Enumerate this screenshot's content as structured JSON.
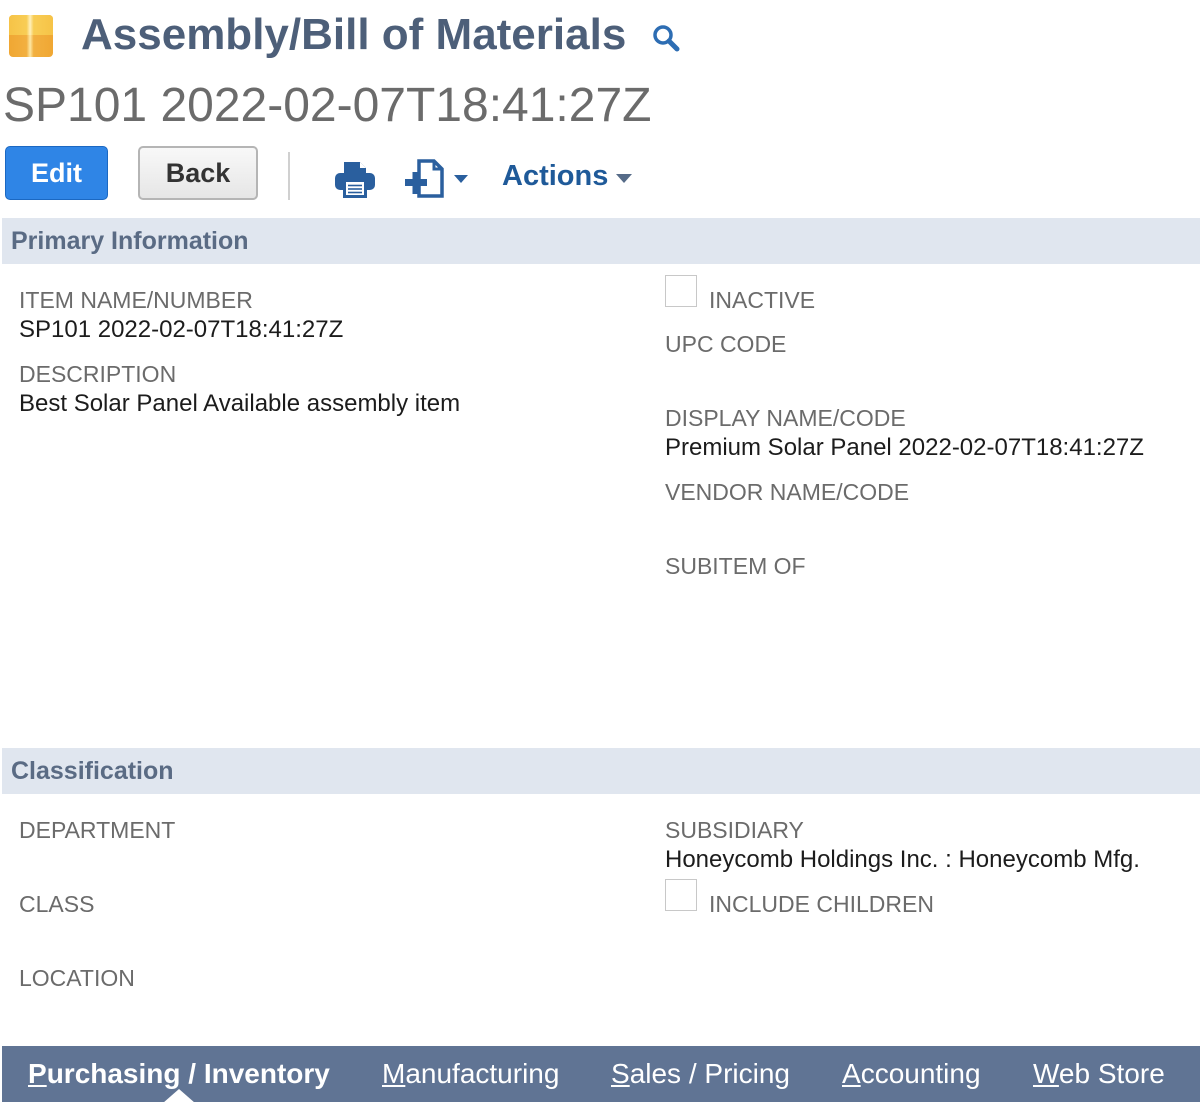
{
  "header": {
    "record_type": "Assembly/Bill of Materials",
    "record_title": "SP101 2022-02-07T18:41:27Z",
    "icons": {
      "record": "package-icon",
      "search": "search-icon"
    }
  },
  "toolbar": {
    "edit_label": "Edit",
    "back_label": "Back",
    "print_icon": "print-icon",
    "new_doc_icon": "new-document-icon",
    "actions_label": "Actions"
  },
  "primary": {
    "title": "Primary Information",
    "item_name_label": "ITEM NAME/NUMBER",
    "item_name_value": "SP101 2022-02-07T18:41:27Z",
    "description_label": "DESCRIPTION",
    "description_value": "Best Solar Panel Available assembly item",
    "inactive_label": "INACTIVE",
    "inactive_checked": false,
    "upc_label": "UPC CODE",
    "upc_value": "",
    "display_name_label": "DISPLAY NAME/CODE",
    "display_name_value": "Premium Solar Panel 2022-02-07T18:41:27Z",
    "vendor_name_label": "VENDOR NAME/CODE",
    "vendor_name_value": "",
    "subitem_label": "SUBITEM OF",
    "subitem_value": ""
  },
  "classification": {
    "title": "Classification",
    "department_label": "DEPARTMENT",
    "department_value": "",
    "class_label": "CLASS",
    "class_value": "",
    "location_label": "LOCATION",
    "location_value": "",
    "subsidiary_label": "SUBSIDIARY",
    "subsidiary_value": "Honeycomb Holdings Inc. : Honeycomb Mfg.",
    "include_children_label": "INCLUDE CHILDREN",
    "include_children_checked": false
  },
  "subtabs": [
    {
      "access_key": "P",
      "rest": "urchasing / Inventory",
      "active": true
    },
    {
      "access_key": "M",
      "rest": "anufacturing",
      "active": false
    },
    {
      "access_key": "S",
      "rest": "ales / Pricing",
      "active": false
    },
    {
      "access_key": "A",
      "rest": "ccounting",
      "active": false
    },
    {
      "access_key": "W",
      "rest": "eb Store",
      "active": false
    }
  ],
  "colors": {
    "primary_button": "#2f85e6",
    "section_bar": "#e0e6ef",
    "subtab_bar": "#607494",
    "link": "#1f5a99"
  }
}
